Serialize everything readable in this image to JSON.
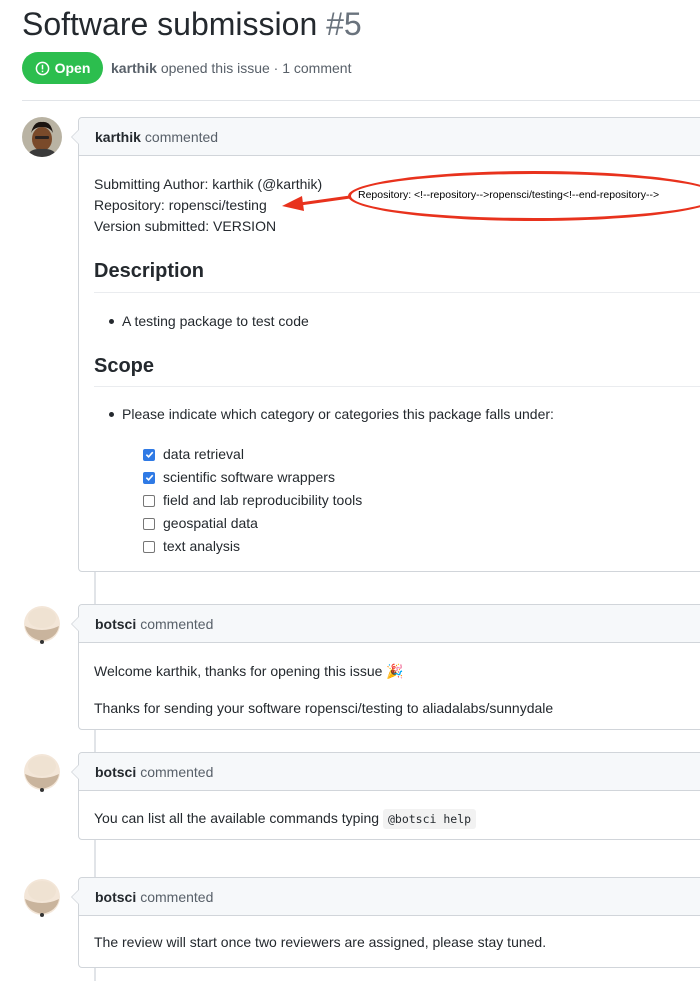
{
  "issue": {
    "title": "Software submission",
    "number": "#5",
    "state": "Open",
    "state_color": "#2cbe4e",
    "author": "karthik",
    "meta_text": "opened this issue · 1 comment"
  },
  "comments": [
    {
      "author": "karthik",
      "action": "commented",
      "avatar": "photo-avatar",
      "lines": {
        "submitting_author": "Submitting Author: karthik (@karthik)",
        "repository": "Repository: ropensci/testing",
        "version": "Version submitted: VERSION"
      },
      "description_heading": "Description",
      "description_item": "A testing package to test code",
      "scope_heading": "Scope",
      "scope_item": "Please indicate which category or categories this package falls under:",
      "checklist": [
        {
          "label": "data retrieval",
          "checked": true
        },
        {
          "label": "scientific software wrappers",
          "checked": true
        },
        {
          "label": "field and lab reproducibility tools",
          "checked": false
        },
        {
          "label": "geospatial data",
          "checked": false
        },
        {
          "label": "text analysis",
          "checked": false
        }
      ]
    },
    {
      "author": "botsci",
      "action": "commented",
      "avatar": "bot-avatar",
      "welcome": "Welcome karthik, thanks for opening this issue",
      "emoji": "🎉",
      "thanks": "Thanks for sending your software ropensci/testing to aliadalabs/sunnydale"
    },
    {
      "author": "botsci",
      "action": "commented",
      "avatar": "bot-avatar",
      "text": "You can list all the available commands typing",
      "code": "@botsci help"
    },
    {
      "author": "botsci",
      "action": "commented",
      "avatar": "bot-avatar",
      "text": "The review will start once two reviewers are assigned, please stay tuned."
    }
  ],
  "annotation": {
    "text": "Repository: <!--repository-->ropensci/testing<!--end-repository-->",
    "color": "#e8321d"
  }
}
